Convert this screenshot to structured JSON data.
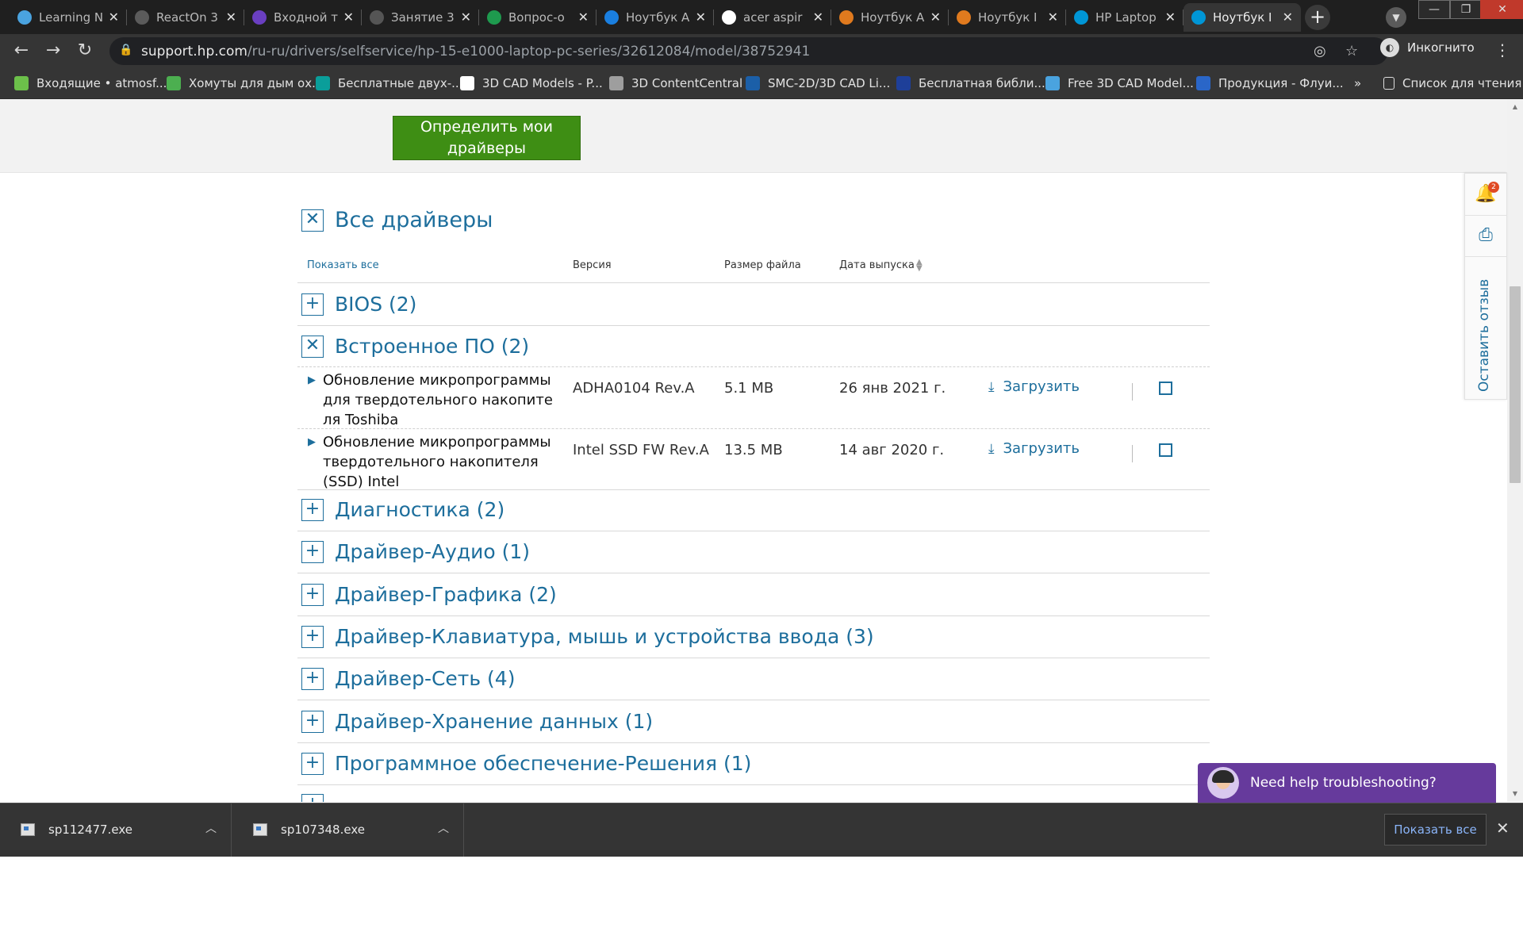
{
  "browser": {
    "tabs": [
      {
        "label": "Learning N",
        "icon": "circle-icon",
        "color": "#4aa3df"
      },
      {
        "label": "ReactOn 3",
        "icon": "s-logo-icon",
        "color": "#5b5b5b"
      },
      {
        "label": "Входной т",
        "icon": "list-icon",
        "color": "#6a3fc1"
      },
      {
        "label": "Занятие 3",
        "icon": "book-icon",
        "color": "#555555"
      },
      {
        "label": "Вопрос-о",
        "icon": "plus-icon",
        "color": "#1e9a4e"
      },
      {
        "label": "Ноутбук A",
        "icon": "d-icon",
        "color": "#1a7fe0"
      },
      {
        "label": "acer aspir",
        "icon": "google-icon",
        "color": "#ffffff"
      },
      {
        "label": "Ноутбук A",
        "icon": "fox-icon",
        "color": "#e07a1e"
      },
      {
        "label": "Ноутбук I",
        "icon": "fox-icon",
        "color": "#e07a1e"
      },
      {
        "label": "HP Laptop",
        "icon": "hp-icon",
        "color": "#0096d6"
      },
      {
        "label": "Ноутбук I",
        "icon": "hp-icon",
        "color": "#0096d6"
      }
    ],
    "url_host": "support.hp.com",
    "url_path": "/ru-ru/drivers/selfservice/hp-15-e1000-laptop-pc-series/32612084/model/38752941",
    "incognito_label": "Инкогнито",
    "bookmarks": [
      {
        "label": "Входящие • atmosf...",
        "color": "#6cc04a"
      },
      {
        "label": "Хомуты для дым ох...",
        "color": "#4caf50"
      },
      {
        "label": "Бесплатные двух-...",
        "color": "#0a9e9a"
      },
      {
        "label": "3D CAD Models - P...",
        "color": "#ffffff"
      },
      {
        "label": "3D ContentCentral",
        "color": "#9e9e9e"
      },
      {
        "label": "SMC-2D/3D CAD Li...",
        "color": "#1b5fa8"
      },
      {
        "label": "Бесплатная библи...",
        "color": "#1e3f99"
      },
      {
        "label": "Free 3D CAD Model...",
        "color": "#4aa3df"
      },
      {
        "label": "Продукция - Флуи...",
        "color": "#2a66c8"
      }
    ],
    "more_bookmarks": "»",
    "reading_list": "Список для чтения"
  },
  "page": {
    "detect_button": "Определить мои драйверы",
    "all_drivers_title": "Все драйверы",
    "columns": {
      "show_all": "Показать все",
      "version": "Версия",
      "size": "Размер файла",
      "date": "Дата выпуска"
    },
    "categories_top": [
      {
        "name": "BIOS (2)",
        "expanded": false
      },
      {
        "name": "Встроенное ПО (2)",
        "expanded": true
      }
    ],
    "drivers": [
      {
        "name": "Обновление микропрограммы для твердотельного накопителя Toshiba",
        "version": "ADHA0104 Rev.A",
        "size": "5.1 MB",
        "date": "26 янв 2021 г.",
        "download": "Загрузить"
      },
      {
        "name": "Обновление микропрограммы твердотельного накопителя (SSD) Intel",
        "version": "Intel SSD FW Rev.A",
        "size": "13.5 MB",
        "date": "14 авг 2020 г.",
        "download": "Загрузить"
      }
    ],
    "categories_bottom": [
      {
        "name": "Диагностика (2)"
      },
      {
        "name": "Драйвер-Аудио (1)"
      },
      {
        "name": "Драйвер-Графика (2)"
      },
      {
        "name": "Драйвер-Клавиатура, мышь и устройства ввода (3)"
      },
      {
        "name": "Драйвер-Сеть (4)"
      },
      {
        "name": "Драйвер-Хранение данных (1)"
      },
      {
        "name": "Программное обеспечение-Решения (1)"
      }
    ],
    "side_panel": {
      "notification_count": "2",
      "feedback_label": "Оставить отзыв"
    },
    "chat_label": "Need help troubleshooting?"
  },
  "downloads": {
    "items": [
      "sp112477.exe",
      "sp107348.exe"
    ],
    "show_all": "Показать все"
  }
}
